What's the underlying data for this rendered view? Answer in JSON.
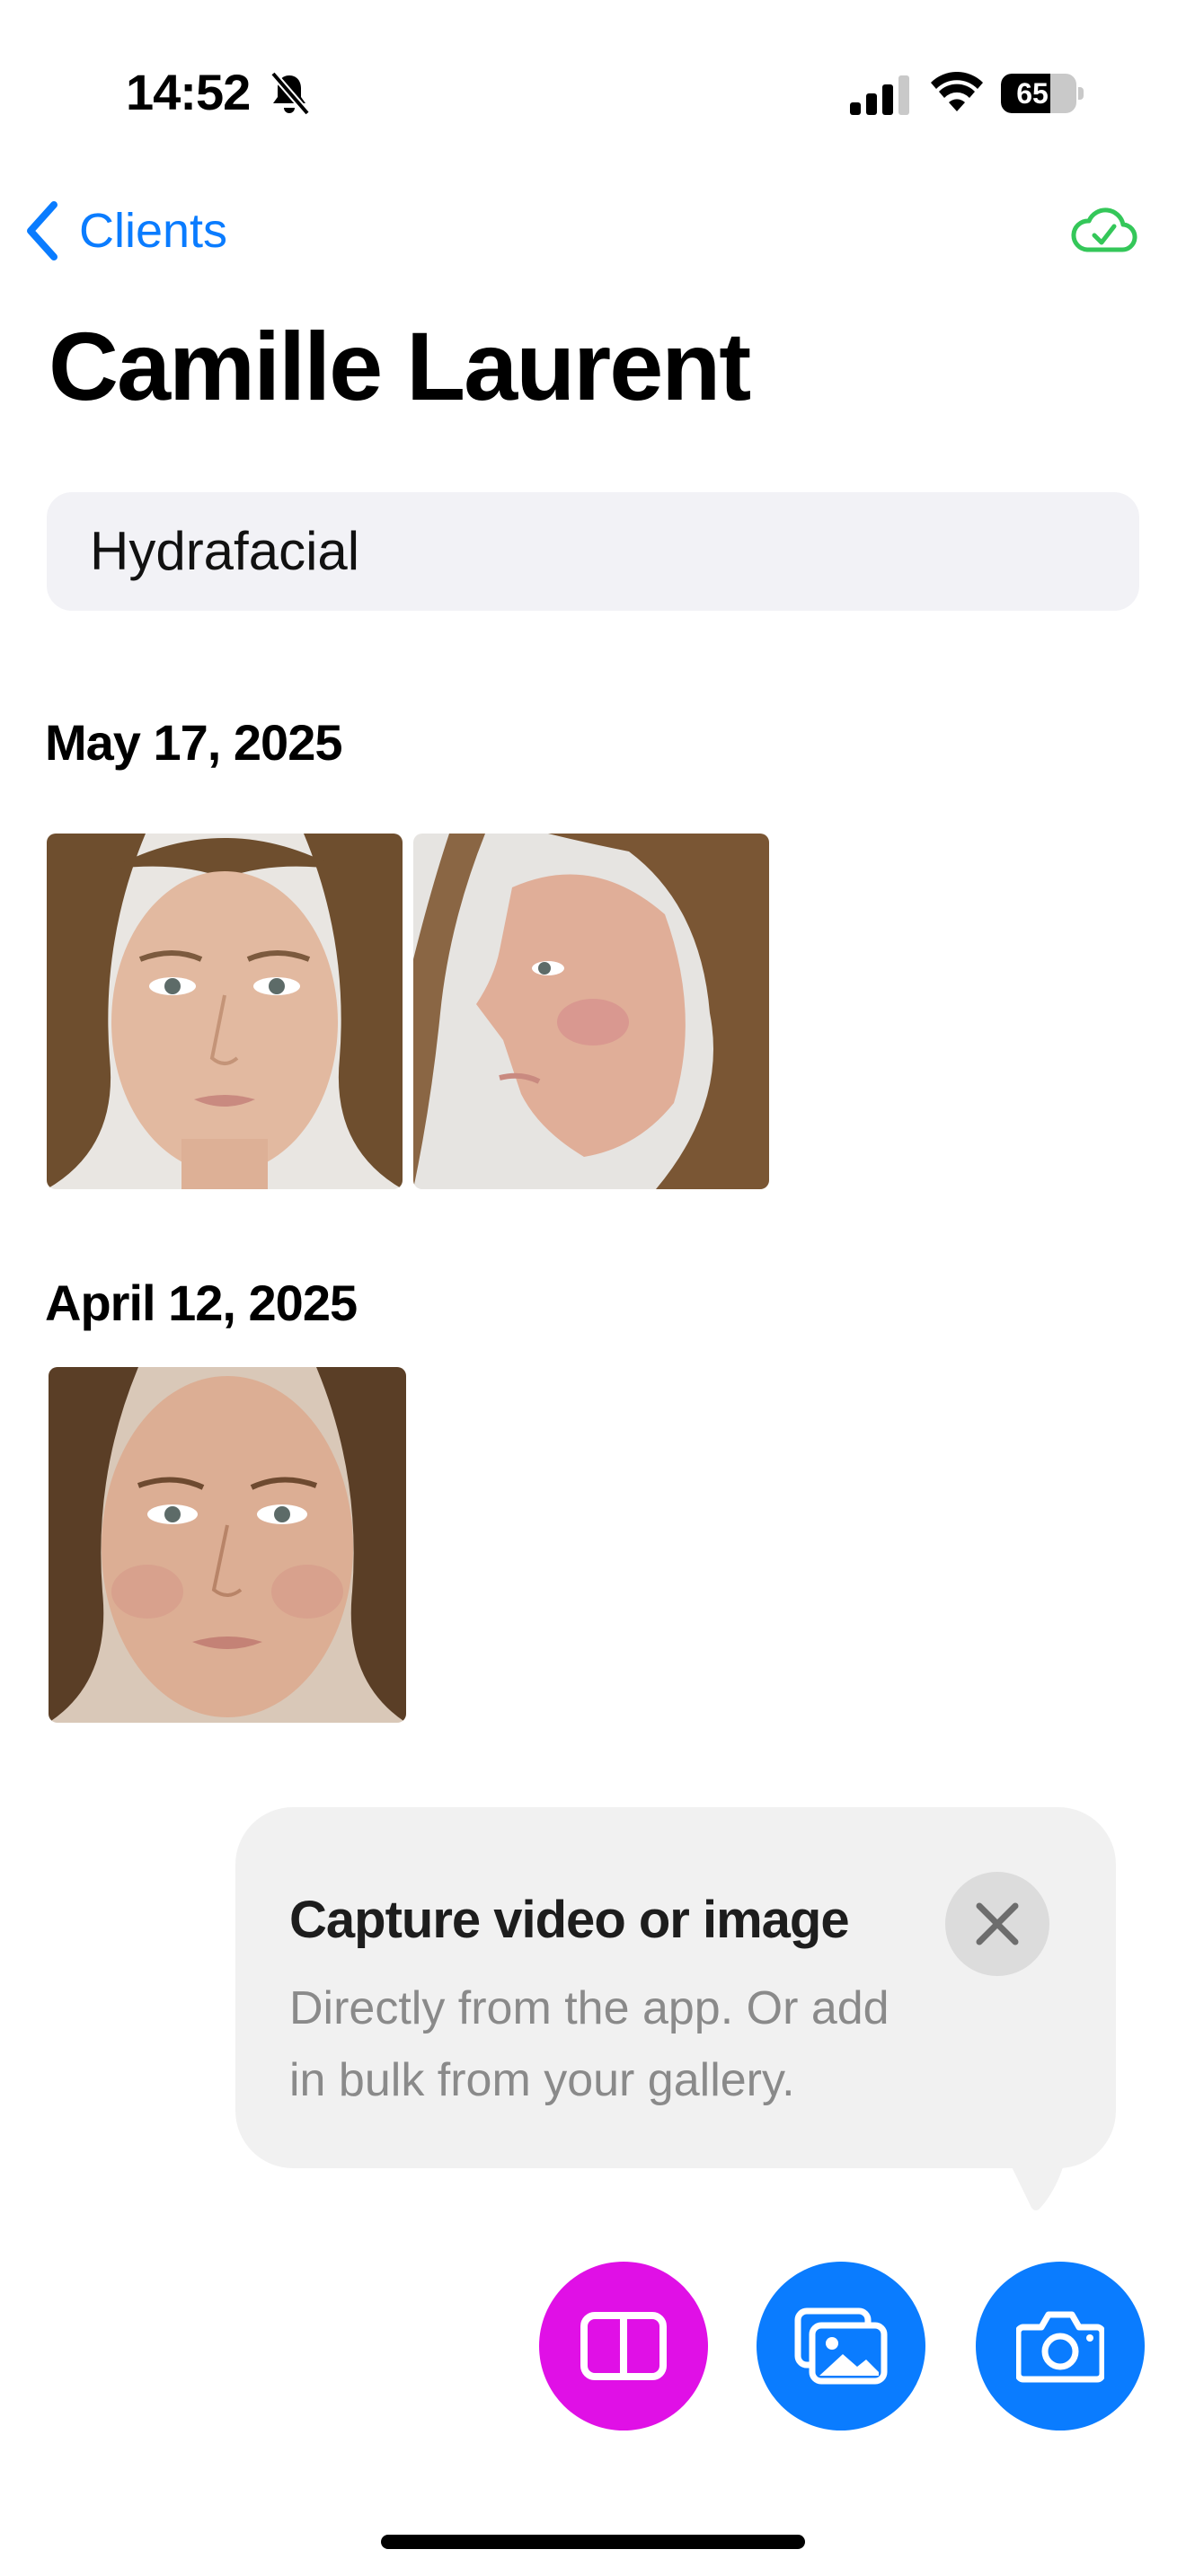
{
  "status_bar": {
    "time": "14:52",
    "battery": "65",
    "battery_level": 0.65
  },
  "nav": {
    "back_label": "Clients"
  },
  "client": {
    "name": "Camille Laurent",
    "treatment": "Hydrafacial"
  },
  "sessions": [
    {
      "date": "May 17, 2025",
      "photos": [
        "front-face-photo",
        "side-face-photo"
      ]
    },
    {
      "date": "April 12, 2025",
      "photos": [
        "front-face-photo"
      ]
    }
  ],
  "tooltip": {
    "title": "Capture video or image",
    "body": "Directly from the app. Or add in bulk from your gallery."
  },
  "actions": [
    "compare-icon",
    "gallery-icon",
    "camera-icon"
  ],
  "colors": {
    "accent_blue": "#0a7cff",
    "compare_magenta": "#e010e6",
    "sync_green": "#34c759",
    "field_gray": "#f2f2f6"
  }
}
